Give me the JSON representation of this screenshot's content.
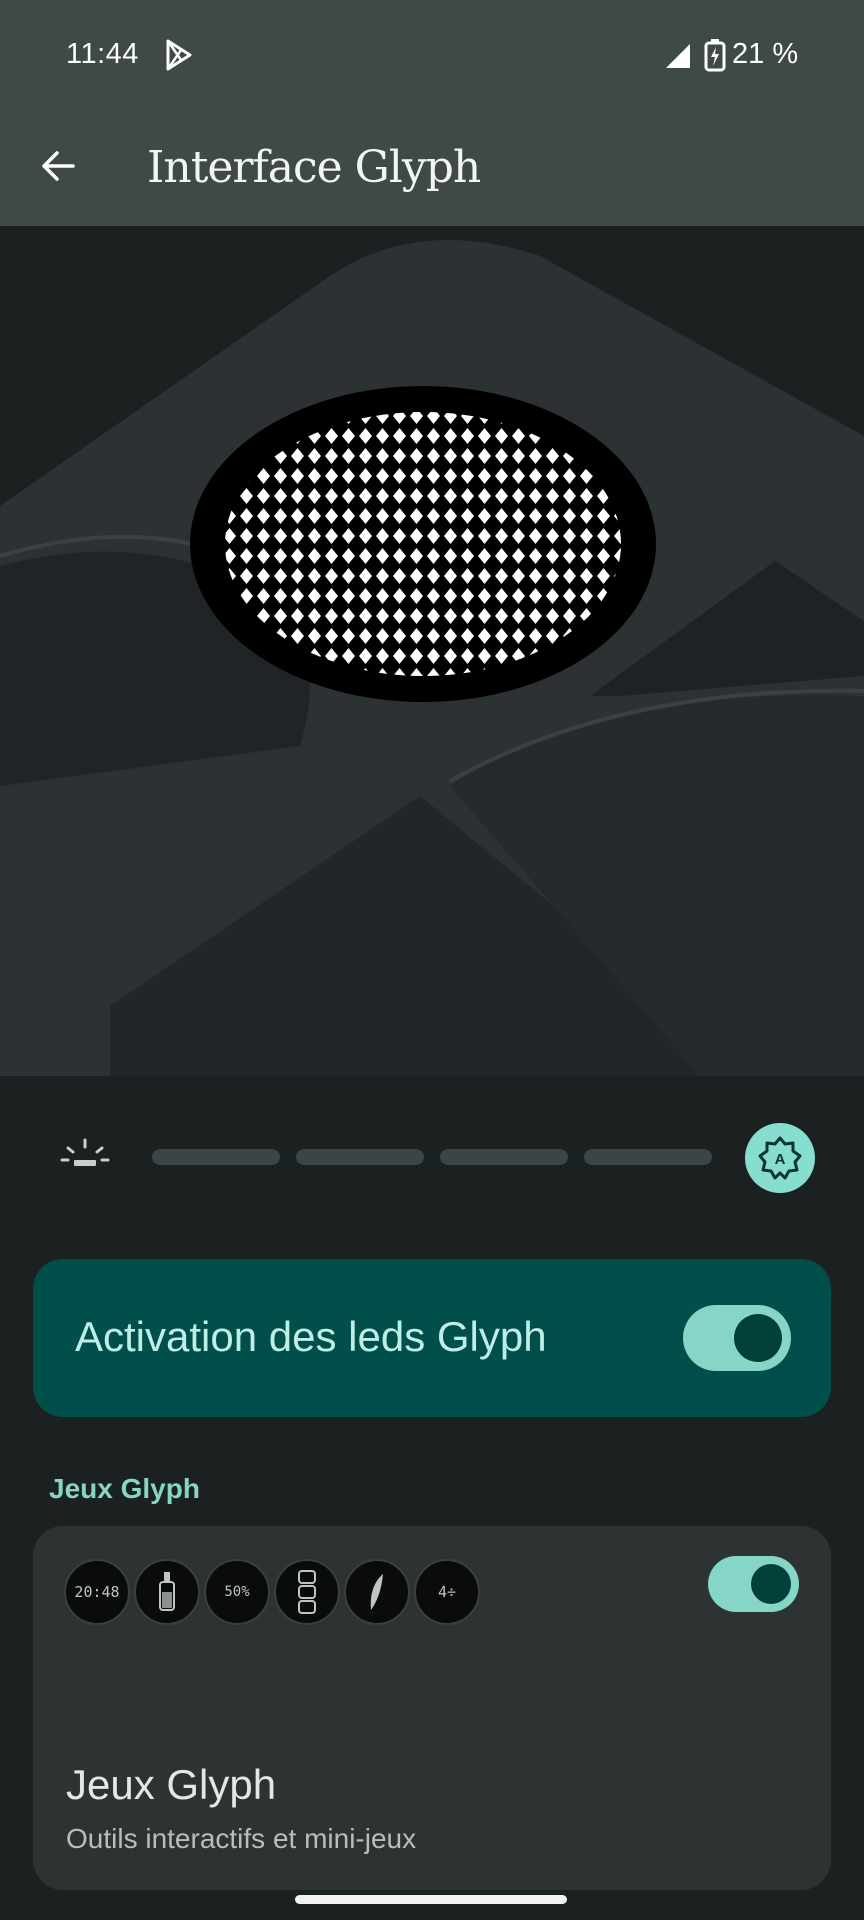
{
  "status_bar": {
    "time": "11:44",
    "battery_text": "21 %",
    "icons": [
      "play-store-icon",
      "signal-icon",
      "battery-charging-icon"
    ]
  },
  "app_bar": {
    "back_icon": "arrow-left-icon",
    "title": "Interface Glyph"
  },
  "hero": {
    "image": "phone-glyph-led-ring-illustration"
  },
  "brightness": {
    "low_icon": "dim-brightness-icon",
    "auto_icon": "auto-brightness-icon",
    "auto_letter": "A",
    "segments": 4,
    "auto_enabled": true
  },
  "activation": {
    "label": "Activation des leds Glyph",
    "enabled": true
  },
  "games_section": {
    "header": "Jeux Glyph",
    "icons": [
      {
        "name": "clock-game-icon",
        "text": "20:48"
      },
      {
        "name": "bottle-game-icon",
        "text": ""
      },
      {
        "name": "progress-game-icon",
        "text": "50%"
      },
      {
        "name": "counter-game-icon",
        "text": ""
      },
      {
        "name": "feather-game-icon",
        "text": ""
      },
      {
        "name": "math-game-icon",
        "text": "4÷"
      }
    ],
    "title": "Jeux Glyph",
    "subtitle": "Outils interactifs et mini-jeux",
    "enabled": true
  },
  "colors": {
    "app_bar": "#3f4948",
    "background": "#1b2021",
    "accent": "#86d6c8",
    "activation_card": "#004f4a",
    "games_card": "#2d3232"
  }
}
